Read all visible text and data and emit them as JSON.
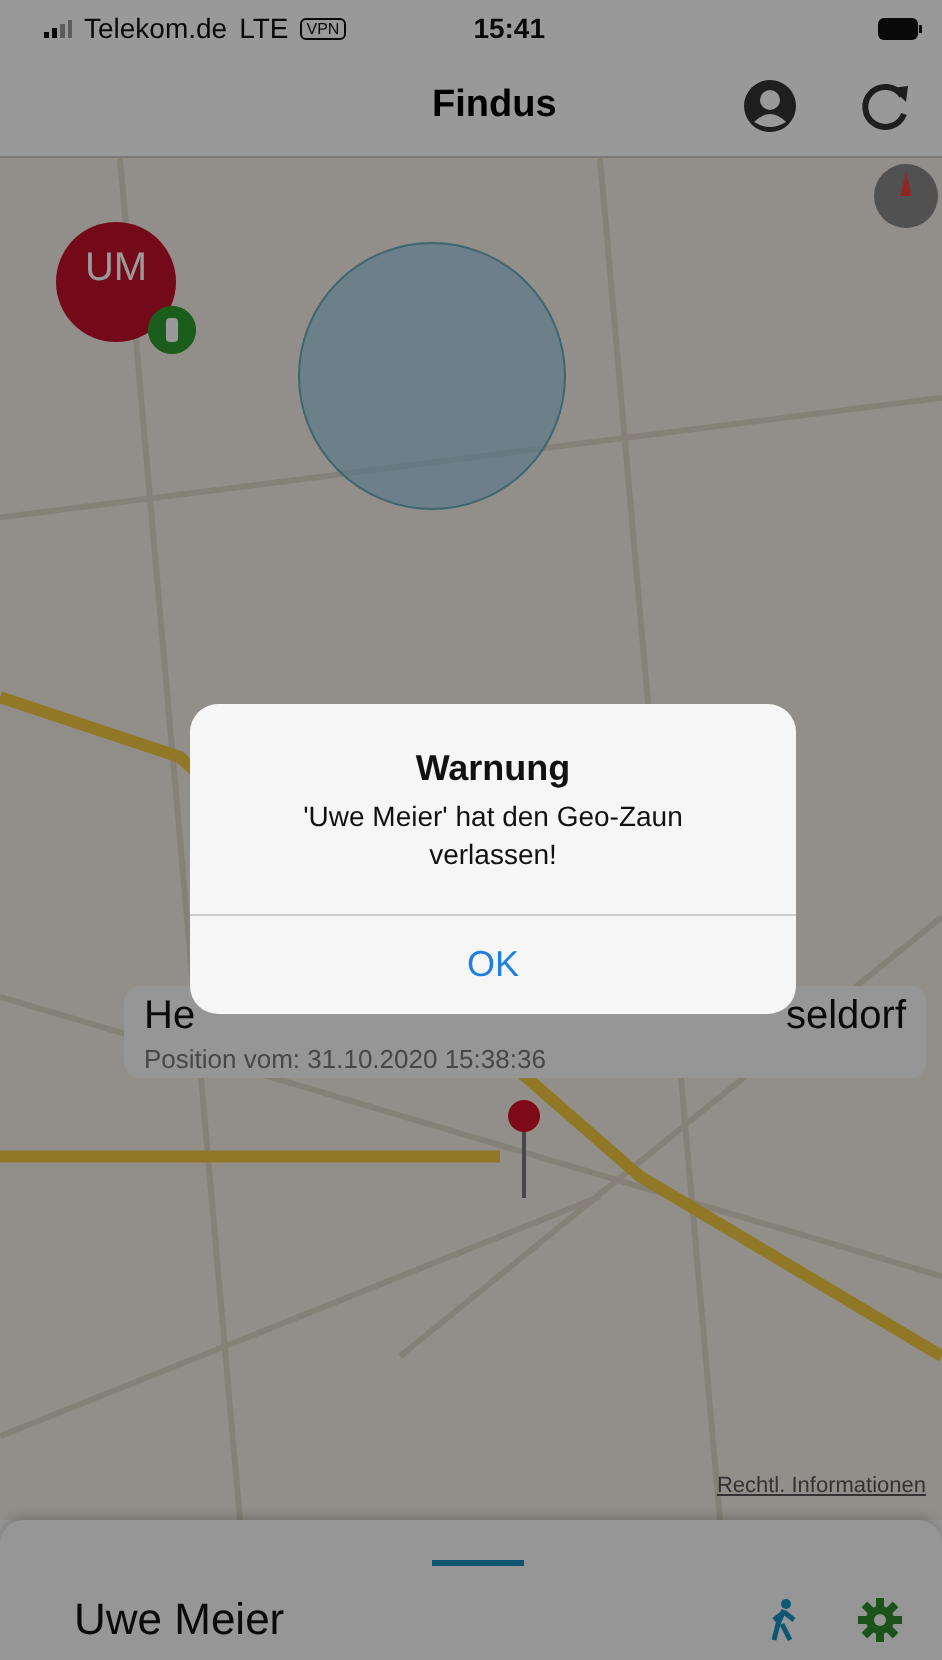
{
  "status_bar": {
    "carrier": "Telekom.de",
    "network": "LTE",
    "vpn": "VPN",
    "time": "15:41"
  },
  "nav_bar": {
    "title": "Findus"
  },
  "map": {
    "avatar": {
      "initials": "UM"
    },
    "callout": {
      "title_start": "He",
      "title_end": "seldorf",
      "subtitle": "Position vom: 31.10.2020 15:38:36"
    },
    "legal_link": "Rechtl. Informationen"
  },
  "alert": {
    "title": "Warnung",
    "message": "'Uwe Meier' hat den Geo-Zaun verlassen!",
    "button": "OK"
  },
  "bottom_sheet": {
    "name": "Uwe Meier"
  }
}
